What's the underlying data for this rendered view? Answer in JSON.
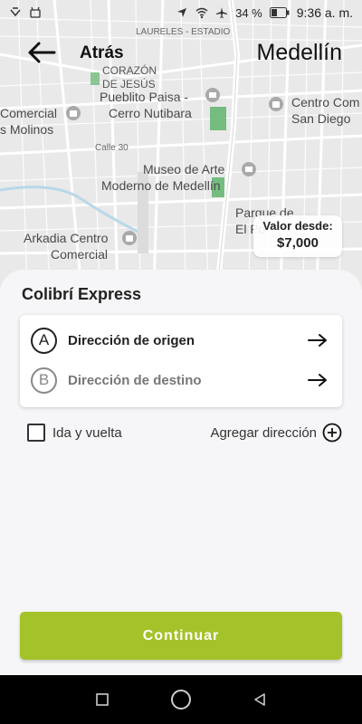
{
  "status_bar": {
    "battery": "34 %",
    "time": "9:36 a. m."
  },
  "header": {
    "back_label": "Atrás",
    "city": "Medellín"
  },
  "map": {
    "labels": {
      "estadio": "LAURELES - ESTADIO",
      "corazon": "CORAZÓN",
      "de_jesus": "DE JESÚS",
      "pueblito": "Pueblito Paisa -",
      "cerro": "Cerro Nutibara",
      "comercial": "Comercial",
      "molinos": "s Molinos",
      "calle": "Calle 30",
      "museo": "Museo de Arte",
      "moderno": "Moderno de Medellín",
      "centro": "Centro Com",
      "sandiego": "San Diego",
      "parque": "Parque de",
      "poblado": "El Po",
      "arkadia": "Arkadia Centro",
      "arkadia2": "Comercial"
    }
  },
  "price_chip": {
    "label": "Valor desde:",
    "value": "$7,000"
  },
  "sheet": {
    "title": "Colibrí Express",
    "origin": {
      "badge": "A",
      "label": "Dirección de origen"
    },
    "destination": {
      "badge": "B",
      "label": "Dirección de destino"
    },
    "round_trip_label": "Ida y vuelta",
    "add_address_label": "Agregar dirección",
    "continue_label": "Continuar"
  },
  "colors": {
    "accent": "#a4c32a",
    "map_bg": "#e9e9ea",
    "park": "#5fb46c"
  }
}
